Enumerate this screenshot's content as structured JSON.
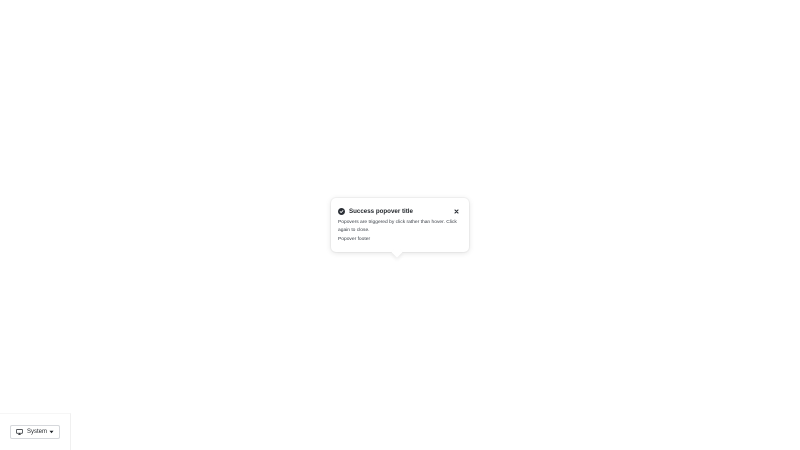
{
  "popover": {
    "icon": "success-check-icon",
    "title": "Success popover title",
    "body": "Popovers are triggered by click rather than hover. Click again to close.",
    "footer": "Popover footer",
    "close_icon": "close-icon"
  },
  "theme_switcher": {
    "icon": "monitor-icon",
    "selected": "System",
    "caret_icon": "caret-down-icon"
  },
  "colors": {
    "background": "#ffffff",
    "text": "#1f2328",
    "icon_fill": "#2b2f36",
    "border": "#d6d8dc"
  }
}
